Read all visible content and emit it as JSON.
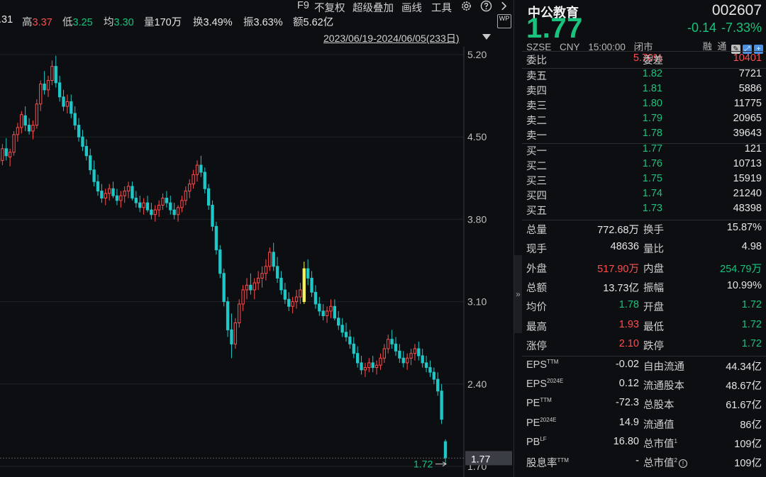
{
  "topbar": {
    "stats": [
      {
        "label": "",
        "value": ".31",
        "color": "white"
      },
      {
        "label": "高",
        "value": "3.37",
        "color": "red"
      },
      {
        "label": "低",
        "value": "3.25",
        "color": "green"
      },
      {
        "label": "均",
        "value": "3.30",
        "color": "green"
      },
      {
        "label": "量",
        "value": "170万",
        "color": "white"
      },
      {
        "label": "换",
        "value": "3.49%",
        "color": "white"
      },
      {
        "label": "振",
        "value": "3.63%",
        "color": "white"
      },
      {
        "label": "额",
        "value": "5.62亿",
        "color": "white"
      }
    ],
    "menu": [
      "F9",
      "不复权",
      "超级叠加",
      "画线",
      "工具"
    ],
    "date_range": "2023/06/19-2024/06/05(233日)",
    "wp_badge": "WP"
  },
  "chart_data": {
    "type": "candlestick",
    "y_ticks": [
      "5.20",
      "4.50",
      "3.80",
      "3.10",
      "2.40",
      "1.70"
    ],
    "ylim": [
      1.7,
      5.2
    ],
    "current_price_label": "1.77",
    "low_marker_label": "1.72",
    "up_color": "#ff4d4f",
    "down_color": "#1fc7c7",
    "highlight_color": "#f5f05b",
    "candles": [
      [
        4.28,
        4.36,
        4.22,
        4.32
      ],
      [
        4.3,
        4.44,
        4.26,
        4.4
      ],
      [
        4.4,
        4.49,
        4.3,
        4.34
      ],
      [
        4.33,
        4.4,
        4.25,
        4.37
      ],
      [
        4.37,
        4.55,
        4.34,
        4.52
      ],
      [
        4.52,
        4.62,
        4.46,
        4.58
      ],
      [
        4.58,
        4.72,
        4.53,
        4.69
      ],
      [
        4.68,
        4.76,
        4.55,
        4.6
      ],
      [
        4.6,
        4.66,
        4.52,
        4.55
      ],
      [
        4.55,
        4.64,
        4.48,
        4.6
      ],
      [
        4.6,
        4.82,
        4.57,
        4.78
      ],
      [
        4.78,
        4.98,
        4.72,
        4.95
      ],
      [
        4.95,
        5.06,
        4.86,
        4.9
      ],
      [
        4.9,
        5.02,
        4.84,
        4.98
      ],
      [
        4.98,
        5.15,
        4.94,
        5.1
      ],
      [
        5.1,
        5.19,
        4.92,
        4.96
      ],
      [
        4.96,
        5.02,
        4.8,
        4.84
      ],
      [
        4.84,
        4.9,
        4.72,
        4.76
      ],
      [
        4.76,
        4.86,
        4.7,
        4.8
      ],
      [
        4.8,
        4.86,
        4.66,
        4.7
      ],
      [
        4.7,
        4.76,
        4.56,
        4.6
      ],
      [
        4.6,
        4.66,
        4.46,
        4.5
      ],
      [
        4.5,
        4.56,
        4.38,
        4.42
      ],
      [
        4.42,
        4.48,
        4.3,
        4.34
      ],
      [
        4.34,
        4.4,
        4.18,
        4.22
      ],
      [
        4.22,
        4.3,
        4.08,
        4.12
      ],
      [
        4.12,
        4.18,
        4.0,
        4.04
      ],
      [
        4.04,
        4.1,
        3.94,
        3.98
      ],
      [
        3.98,
        4.06,
        3.92,
        4.02
      ],
      [
        4.02,
        4.1,
        3.96,
        4.06
      ],
      [
        4.06,
        4.12,
        3.98,
        4.0
      ],
      [
        4.0,
        4.06,
        3.92,
        3.96
      ],
      [
        3.96,
        4.04,
        3.9,
        4.0
      ],
      [
        4.0,
        4.08,
        3.94,
        4.04
      ],
      [
        4.04,
        4.12,
        3.98,
        4.08
      ],
      [
        4.08,
        4.12,
        3.96,
        3.98
      ],
      [
        3.98,
        4.04,
        3.9,
        3.94
      ],
      [
        3.94,
        4.0,
        3.86,
        3.9
      ],
      [
        3.9,
        3.98,
        3.84,
        3.94
      ],
      [
        3.94,
        4.0,
        3.86,
        3.88
      ],
      [
        3.88,
        3.94,
        3.8,
        3.84
      ],
      [
        3.84,
        3.92,
        3.78,
        3.88
      ],
      [
        3.88,
        3.96,
        3.82,
        3.92
      ],
      [
        3.92,
        4.02,
        3.88,
        3.98
      ],
      [
        3.98,
        4.04,
        3.9,
        3.94
      ],
      [
        3.94,
        4.0,
        3.84,
        3.88
      ],
      [
        3.88,
        3.94,
        3.8,
        3.84
      ],
      [
        3.84,
        3.92,
        3.78,
        3.9
      ],
      [
        3.9,
        4.0,
        3.86,
        3.96
      ],
      [
        3.96,
        4.08,
        3.92,
        4.04
      ],
      [
        4.04,
        4.14,
        3.98,
        4.1
      ],
      [
        4.1,
        4.22,
        4.06,
        4.18
      ],
      [
        4.18,
        4.3,
        4.12,
        4.26
      ],
      [
        4.26,
        4.34,
        4.16,
        4.2
      ],
      [
        4.2,
        4.24,
        4.02,
        4.06
      ],
      [
        4.06,
        4.1,
        3.88,
        3.92
      ],
      [
        3.92,
        3.96,
        3.7,
        3.74
      ],
      [
        3.74,
        3.78,
        3.5,
        3.54
      ],
      [
        3.54,
        3.58,
        3.3,
        3.34
      ],
      [
        3.34,
        3.38,
        3.06,
        3.1
      ],
      [
        3.1,
        3.14,
        2.8,
        2.86
      ],
      [
        2.86,
        3.0,
        2.62,
        2.74
      ],
      [
        2.74,
        2.96,
        2.7,
        2.92
      ],
      [
        2.92,
        3.12,
        2.88,
        3.08
      ],
      [
        3.08,
        3.24,
        3.02,
        3.2
      ],
      [
        3.2,
        3.3,
        3.12,
        3.24
      ],
      [
        3.24,
        3.34,
        3.16,
        3.2
      ],
      [
        3.2,
        3.3,
        3.12,
        3.26
      ],
      [
        3.26,
        3.36,
        3.2,
        3.3
      ],
      [
        3.3,
        3.4,
        3.22,
        3.34
      ],
      [
        3.34,
        3.46,
        3.28,
        3.4
      ],
      [
        3.4,
        3.56,
        3.36,
        3.52
      ],
      [
        3.52,
        3.6,
        3.36,
        3.4
      ],
      [
        3.4,
        3.48,
        3.26,
        3.3
      ],
      [
        3.3,
        3.36,
        3.16,
        3.2
      ],
      [
        3.2,
        3.26,
        3.08,
        3.12
      ],
      [
        3.12,
        3.18,
        3.02,
        3.06
      ],
      [
        3.06,
        3.14,
        3.0,
        3.1
      ],
      [
        3.1,
        3.2,
        3.04,
        3.14
      ],
      [
        3.14,
        3.26,
        3.08,
        3.2
      ],
      [
        3.1,
        3.44,
        3.08,
        3.38
      ],
      [
        3.38,
        3.46,
        3.24,
        3.3
      ],
      [
        3.3,
        3.36,
        3.14,
        3.18
      ],
      [
        3.18,
        3.24,
        3.04,
        3.08
      ],
      [
        3.08,
        3.14,
        2.98,
        3.02
      ],
      [
        3.02,
        3.08,
        2.94,
        2.98
      ],
      [
        2.98,
        3.06,
        2.92,
        3.02
      ],
      [
        3.02,
        3.12,
        2.96,
        3.06
      ],
      [
        3.06,
        3.12,
        2.94,
        2.96
      ],
      [
        2.96,
        3.02,
        2.86,
        2.9
      ],
      [
        2.9,
        2.96,
        2.8,
        2.84
      ],
      [
        2.84,
        2.92,
        2.76,
        2.8
      ],
      [
        2.8,
        2.86,
        2.7,
        2.74
      ],
      [
        2.74,
        2.8,
        2.62,
        2.66
      ],
      [
        2.66,
        2.72,
        2.54,
        2.58
      ],
      [
        2.58,
        2.64,
        2.48,
        2.52
      ],
      [
        2.52,
        2.58,
        2.46,
        2.54
      ],
      [
        2.54,
        2.62,
        2.5,
        2.58
      ],
      [
        2.58,
        2.64,
        2.5,
        2.54
      ],
      [
        2.54,
        2.6,
        2.48,
        2.56
      ],
      [
        2.56,
        2.66,
        2.52,
        2.62
      ],
      [
        2.62,
        2.74,
        2.58,
        2.7
      ],
      [
        2.7,
        2.82,
        2.66,
        2.78
      ],
      [
        2.78,
        2.86,
        2.7,
        2.74
      ],
      [
        2.74,
        2.8,
        2.64,
        2.68
      ],
      [
        2.68,
        2.74,
        2.58,
        2.62
      ],
      [
        2.62,
        2.68,
        2.54,
        2.58
      ],
      [
        2.58,
        2.66,
        2.52,
        2.62
      ],
      [
        2.62,
        2.7,
        2.56,
        2.66
      ],
      [
        2.66,
        2.74,
        2.6,
        2.7
      ],
      [
        2.7,
        2.76,
        2.6,
        2.64
      ],
      [
        2.64,
        2.7,
        2.54,
        2.58
      ],
      [
        2.58,
        2.64,
        2.5,
        2.54
      ],
      [
        2.54,
        2.6,
        2.46,
        2.5
      ],
      [
        2.5,
        2.54,
        2.4,
        2.44
      ],
      [
        2.44,
        2.5,
        2.3,
        2.34
      ],
      [
        2.34,
        2.4,
        2.06,
        2.1
      ],
      [
        1.91,
        1.93,
        1.72,
        1.77
      ]
    ]
  },
  "quote": {
    "name": "中公教育",
    "code": "002607",
    "price": "1.77",
    "change": "-0.14",
    "change_pct": "-7.33%",
    "exchange": "SZSE",
    "currency": "CNY",
    "time": "15:00:00",
    "status": "闭市",
    "tags": [
      "融",
      "通"
    ],
    "commission_ratio_label": "委比",
    "commission_ratio": "5.70%",
    "commission_diff_label": "委差",
    "commission_diff": "10401",
    "asks": [
      {
        "label": "卖五",
        "price": "1.82",
        "volume": "7721"
      },
      {
        "label": "卖四",
        "price": "1.81",
        "volume": "5886"
      },
      {
        "label": "卖三",
        "price": "1.80",
        "volume": "11775"
      },
      {
        "label": "卖二",
        "price": "1.79",
        "volume": "20965"
      },
      {
        "label": "卖一",
        "price": "1.78",
        "volume": "39643"
      }
    ],
    "bids": [
      {
        "label": "买一",
        "price": "1.77",
        "volume": "121"
      },
      {
        "label": "买二",
        "price": "1.76",
        "volume": "10713"
      },
      {
        "label": "买三",
        "price": "1.75",
        "volume": "15919"
      },
      {
        "label": "买四",
        "price": "1.74",
        "volume": "21240"
      },
      {
        "label": "买五",
        "price": "1.73",
        "volume": "48398"
      }
    ],
    "stats": [
      {
        "k1": "总量",
        "v1": "772.68万",
        "c1": "white",
        "k2": "换手",
        "v2": "15.87%",
        "c2": "white"
      },
      {
        "k1": "现手",
        "v1": "48636",
        "c1": "white",
        "k2": "量比",
        "v2": "4.98",
        "c2": "white"
      },
      {
        "k1": "外盘",
        "v1": "517.90万",
        "c1": "red",
        "k2": "内盘",
        "v2": "254.79万",
        "c2": "green"
      },
      {
        "k1": "总额",
        "v1": "13.73亿",
        "c1": "white",
        "k2": "振幅",
        "v2": "10.99%",
        "c2": "white"
      },
      {
        "k1": "均价",
        "v1": "1.78",
        "c1": "green",
        "k2": "开盘",
        "v2": "1.72",
        "c2": "green"
      },
      {
        "k1": "最高",
        "v1": "1.93",
        "c1": "red",
        "k2": "最低",
        "v2": "1.72",
        "c2": "green"
      },
      {
        "k1": "涨停",
        "v1": "2.10",
        "c1": "red",
        "k2": "跌停",
        "v2": "1.72",
        "c2": "green"
      }
    ],
    "fundamentals": [
      {
        "k1": "EPS",
        "s1": "TTM",
        "v1": "-0.02",
        "k2": "自由流通",
        "s2": "",
        "v2": "44.34亿"
      },
      {
        "k1": "EPS",
        "s1": "2024E",
        "v1": "0.12",
        "k2": "流通股本",
        "s2": "",
        "v2": "48.67亿"
      },
      {
        "k1": "PE",
        "s1": "TTM",
        "v1": "-72.3",
        "k2": "总股本",
        "s2": "",
        "v2": "61.67亿"
      },
      {
        "k1": "PE",
        "s1": "2024E",
        "v1": "14.9",
        "k2": "流通值",
        "s2": "",
        "v2": "86亿"
      },
      {
        "k1": "PB",
        "s1": "LF",
        "v1": "16.80",
        "k2": "总市值",
        "s2": "1",
        "v2": "109亿"
      },
      {
        "k1": "股息率",
        "s1": "TTM",
        "v1": "-",
        "k2": "总市值",
        "s2": "2",
        "v2": "109亿"
      }
    ]
  }
}
